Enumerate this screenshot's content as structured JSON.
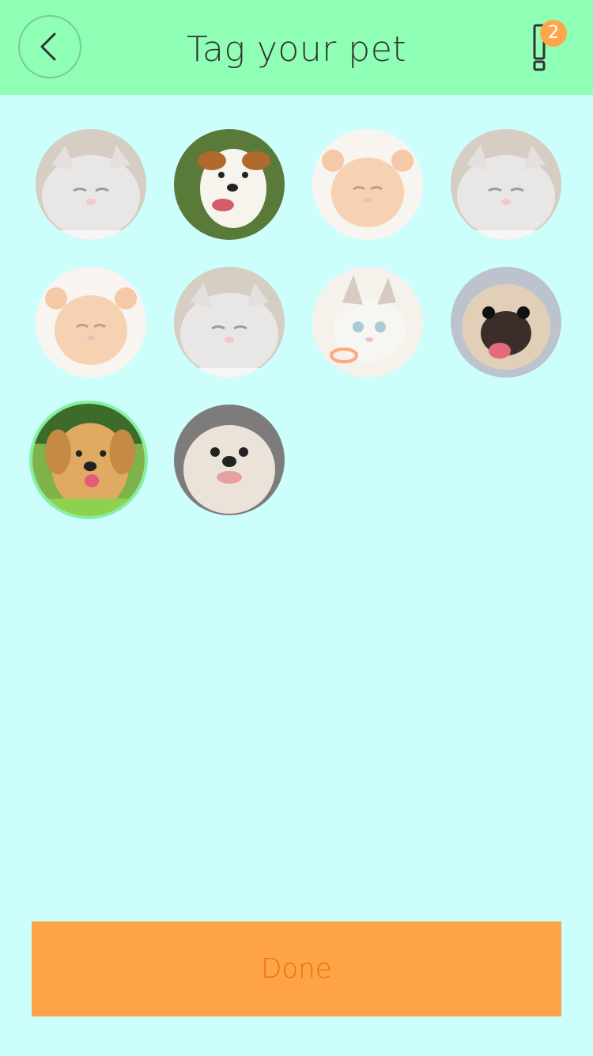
{
  "header": {
    "title": "Tag your pet",
    "back_icon": "chevron-left-icon",
    "alert_icon": "exclamation-icon",
    "alert_badge_count": "2",
    "background": "#8fffb5"
  },
  "pets": [
    {
      "kind": "cat-grey",
      "selected": false
    },
    {
      "kind": "dog-terrier",
      "selected": false
    },
    {
      "kind": "kitten-orange",
      "selected": false
    },
    {
      "kind": "cat-grey",
      "selected": false
    },
    {
      "kind": "kitten-orange",
      "selected": false
    },
    {
      "kind": "cat-grey",
      "selected": false
    },
    {
      "kind": "kitten-siamese",
      "selected": false
    },
    {
      "kind": "dog-pug",
      "selected": false
    },
    {
      "kind": "dog-golden-retriever",
      "selected": true
    },
    {
      "kind": "dog-shih-tzu",
      "selected": false
    }
  ],
  "footer": {
    "done_label": "Done"
  },
  "colors": {
    "page_bg": "#ccfffb",
    "accent": "#ffa347",
    "selected_ring": "#86f0a2"
  }
}
